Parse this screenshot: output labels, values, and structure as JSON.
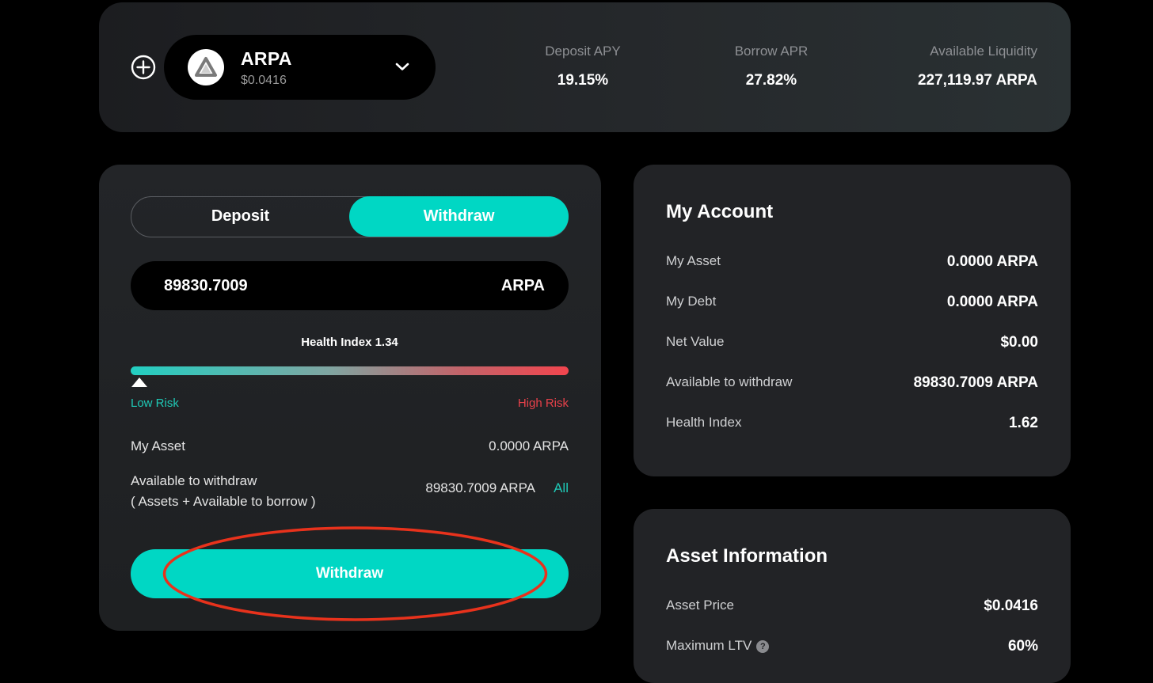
{
  "header": {
    "asset": {
      "symbol": "ARPA",
      "price": "$0.0416"
    },
    "stats": {
      "deposit_apy_label": "Deposit APY",
      "deposit_apy_value": "19.15%",
      "borrow_apr_label": "Borrow APR",
      "borrow_apr_value": "27.82%",
      "liquidity_label": "Available Liquidity",
      "liquidity_value": "227,119.97 ARPA"
    }
  },
  "action": {
    "tabs": {
      "deposit": "Deposit",
      "withdraw": "Withdraw",
      "active": "withdraw"
    },
    "amount_value": "89830.7009",
    "amount_unit": "ARPA",
    "health_label": "Health Index 1.34",
    "health_fraction": 0.0,
    "risk_low": "Low Risk",
    "risk_high": "High Risk",
    "my_asset_label": "My Asset",
    "my_asset_value": "0.0000 ARPA",
    "available_label_line1": "Available to withdraw",
    "available_label_line2": "( Assets + Available to borrow )",
    "available_value": "89830.7009 ARPA",
    "all_label": "All",
    "submit_label": "Withdraw"
  },
  "account": {
    "title": "My Account",
    "rows": [
      {
        "label": "My Asset",
        "value": "0.0000 ARPA"
      },
      {
        "label": "My Debt",
        "value": "0.0000 ARPA"
      },
      {
        "label": "Net Value",
        "value": "$0.00"
      },
      {
        "label": "Available to withdraw",
        "value": "89830.7009 ARPA"
      },
      {
        "label": "Health Index",
        "value": "1.62"
      }
    ]
  },
  "asset_info": {
    "title": "Asset Information",
    "rows": [
      {
        "label": "Asset Price",
        "value": "$0.0416"
      },
      {
        "label": "Maximum LTV",
        "value": "60%"
      }
    ]
  },
  "colors": {
    "accent": "#00d7c4",
    "low_risk": "#1fc9b6",
    "high_risk": "#e7414a",
    "annotation": "#e8321c"
  }
}
